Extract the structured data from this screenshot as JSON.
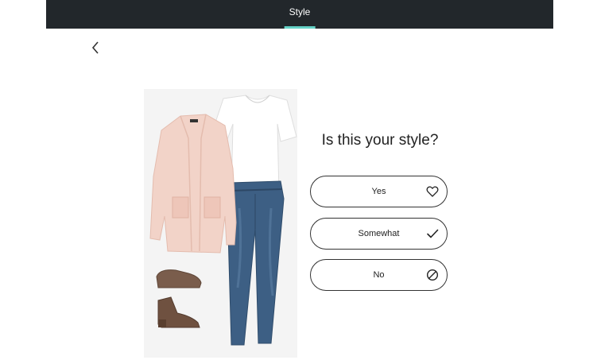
{
  "header": {
    "tab_label": "Style",
    "accent_color": "#64d2c6",
    "bar_color": "#22272b"
  },
  "nav": {
    "back_icon": "chevron-left-icon"
  },
  "outfit": {
    "items": [
      "cardigan",
      "t-shirt",
      "jeans",
      "ankle-boots"
    ]
  },
  "prompt": {
    "question": "Is this your style?"
  },
  "choices": [
    {
      "label": "Yes",
      "icon": "heart-icon"
    },
    {
      "label": "Somewhat",
      "icon": "check-icon"
    },
    {
      "label": "No",
      "icon": "no-entry-icon"
    }
  ]
}
